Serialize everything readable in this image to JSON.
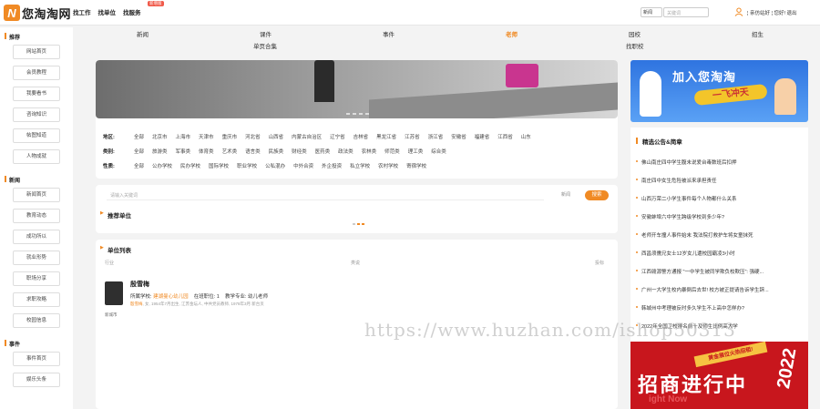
{
  "header": {
    "logo_mark": "N",
    "logo_text": "您淘淘网",
    "nav": [
      "找工作",
      "找单位",
      "找服务"
    ],
    "hot_badge": "新增版",
    "search_select": "新闻",
    "search_placeholder": "关键词",
    "user_links": "¦ 亲仿站好 ¦ 您好! 退出"
  },
  "sidebar": {
    "sections": [
      {
        "title": "推荐",
        "items": [
          "网站首页",
          "会员教程",
          "我要看书",
          "咨询知识",
          "帖图知道",
          "人物成就"
        ]
      },
      {
        "title": "新闻",
        "items": [
          "新闻首页",
          "教育动态",
          "成功所以",
          "就业形势",
          "职场分享",
          "求职攻略",
          "校园信息"
        ]
      },
      {
        "title": "事件",
        "items": [
          "事件首页",
          "娱乐头条"
        ]
      }
    ]
  },
  "catnav": {
    "row1": [
      "新闻",
      "课件",
      "事件",
      "老师",
      "园校",
      "招生"
    ],
    "row2": [
      "单页合集",
      "找职校"
    ],
    "active": "老师"
  },
  "filters": {
    "region_label": "地区:",
    "regions": [
      "全部",
      "北京市",
      "上海市",
      "天津市",
      "重庆市",
      "河北省",
      "山西省",
      "内蒙古自治区",
      "辽宁省",
      "吉林省",
      "黑龙江省",
      "江苏省",
      "浙江省",
      "安徽省",
      "福建省",
      "江西省",
      "山东"
    ],
    "category_label": "类别:",
    "categories": [
      "全部",
      "旅游类",
      "军事类",
      "体育类",
      "艺术类",
      "语言类",
      "民族类",
      "财经类",
      "医药类",
      "政法类",
      "农林类",
      "师范类",
      "理工类",
      "综合类"
    ],
    "nature_label": "性质:",
    "natures": [
      "全部",
      "公办学校",
      "民办学校",
      "国际学校",
      "职业学校",
      "公私混办",
      "中外合资",
      "外企投资",
      "私立学校",
      "农村学校",
      "寄宿学校"
    ]
  },
  "search_card": {
    "placeholder": "请输入关键词",
    "select": "新闻",
    "button": "搜索",
    "title": "推荐单位"
  },
  "list_card": {
    "title": "单位列表",
    "columns": [
      "行业",
      "类说",
      "投标"
    ],
    "person": {
      "name": "殷雪梅",
      "school_label": "所属学校:",
      "school": "建湖曼心幼儿园",
      "duty_label": "在班职位:",
      "duty": "1",
      "major_label": "教学专业:",
      "major": "幼儿老师",
      "detail_name": "殷雪梅",
      "detail": ", 女, 1954年7月出生, 江苏金坛人, 中共党员教师, 1978年3月 新台页",
      "tag": "新城市"
    }
  },
  "right_ad": {
    "title": "加入您淘淘",
    "subtitle": "一飞冲天"
  },
  "news": {
    "title": "精选公告&简章",
    "items": [
      "佛山南庄四中学生腹未说爱台毒数班后扣押",
      "南庄四中女生危险被派来承担责任",
      "山西万荣二小学生事件每个人物都什么关系",
      "安徽蚌埠六中学生跨级学校到多少年?",
      "老师开车撞人事件始末 我法院打救护车将女童抹死",
      "西昌须儒兄女士12岁女儿遭校园霸凌3小时",
      "江西赣源警方通报 \"一中学生被同学欺负校欺压\": 强硬...",
      "广州一大学生校内暴倒后去世! 校方被正提请告诉学生辞...",
      "韩城州中考理被反时多久学生不上高中怎样办?",
      "2022年全国卫校排名前十及师生比例高大学"
    ]
  },
  "red_ad": {
    "top": "黄金展位火热招租!",
    "main": "招商进行中",
    "year": "2022",
    "sub": "ight Now"
  },
  "watermark": "https://www.huzhan.com/ishop50313",
  "colors": {
    "accent": "#f08a24",
    "red": "#c8161d",
    "blue": "#2f74e0"
  }
}
